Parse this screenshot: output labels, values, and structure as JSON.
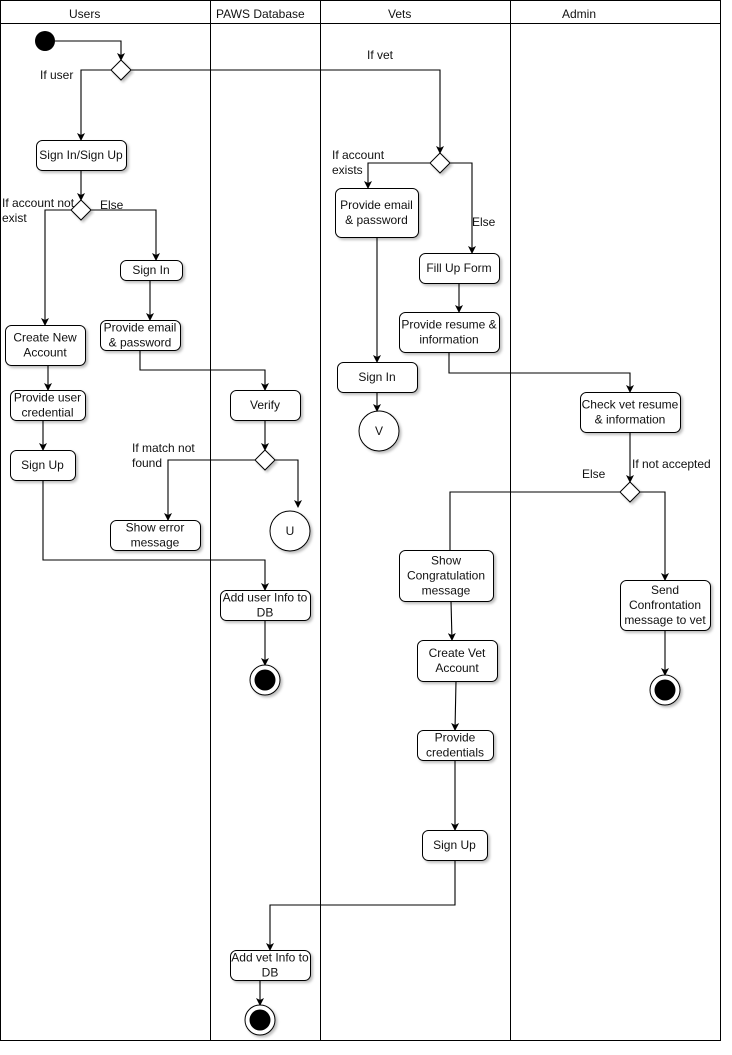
{
  "lanes": [
    "Users",
    "PAWS Database",
    "Vets",
    "Admin"
  ],
  "nodes": {
    "signin_signup": [
      "Sign In/Sign Up"
    ],
    "user_signin": [
      "Sign In"
    ],
    "user_provide_email": [
      "Provide email",
      "& password"
    ],
    "create_account": [
      "Create New",
      "Account"
    ],
    "provide_user_credential": [
      "Provide user",
      "credential"
    ],
    "user_signup": [
      "Sign Up"
    ],
    "verify": [
      "Verify"
    ],
    "show_error": [
      "Show error",
      "message"
    ],
    "add_user_db": [
      "Add user Info to",
      "DB"
    ],
    "vet_provide_email": [
      "Provide email",
      "& password"
    ],
    "fill_form": [
      "Fill Up Form"
    ],
    "provide_resume": [
      "Provide resume &",
      "information"
    ],
    "vet_signin": [
      "Sign In"
    ],
    "check_resume": [
      "Check vet resume",
      "& information"
    ],
    "show_congrats": [
      "Show",
      "Congratulation",
      "message"
    ],
    "send_confrontation": [
      "Send",
      "Confrontation",
      "message to vet"
    ],
    "create_vet_account": [
      "Create Vet",
      "Account"
    ],
    "provide_credentials": [
      "Provide",
      "credentials"
    ],
    "vet_signup": [
      "Sign Up"
    ],
    "add_vet_db": [
      "Add vet Info to",
      "DB"
    ]
  },
  "connectors": {
    "user": "U",
    "vet": "V"
  },
  "guards": {
    "if_user": [
      "If user"
    ],
    "if_vet": [
      "If vet"
    ],
    "if_account_not_exist": [
      "If account not",
      "exist"
    ],
    "else_user": [
      "Else"
    ],
    "if_match_not_found": [
      "If match not",
      "found"
    ],
    "if_account_exists": [
      "If account",
      "exists"
    ],
    "else_vet": [
      "Else"
    ],
    "if_not_accepted": [
      "If not accepted"
    ],
    "else_admin": [
      "Else"
    ]
  }
}
